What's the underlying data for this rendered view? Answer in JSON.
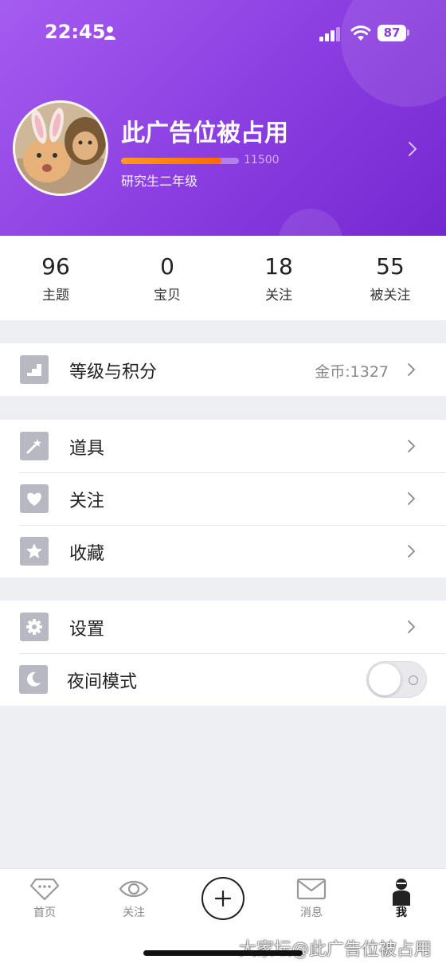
{
  "status_bar": {
    "time": "22:45",
    "battery": "87"
  },
  "profile": {
    "name": "此广告位被占用",
    "progress_value": "11500",
    "progress_fraction": 0.85,
    "level": "研究生二年级"
  },
  "stats": [
    {
      "value": "96",
      "label": "主题"
    },
    {
      "value": "0",
      "label": "宝贝"
    },
    {
      "value": "18",
      "label": "关注"
    },
    {
      "value": "55",
      "label": "被关注"
    }
  ],
  "menu": {
    "level_points": {
      "label": "等级与积分",
      "value": "金币:1327",
      "icon": "stairs-icon"
    },
    "tools": {
      "label": "道具",
      "icon": "magic-wand-icon"
    },
    "follow": {
      "label": "关注",
      "icon": "heart-icon"
    },
    "favorites": {
      "label": "收藏",
      "icon": "star-icon"
    },
    "settings": {
      "label": "设置",
      "icon": "gear-icon"
    },
    "night_mode": {
      "label": "夜间模式",
      "icon": "moon-icon",
      "enabled": false
    }
  },
  "tabbar": {
    "home": "首页",
    "follow": "关注",
    "messages": "消息",
    "me": "我"
  },
  "watermark": "大家坛@此广告位被占用",
  "colors": {
    "header_start": "#a55cf0",
    "header_end": "#7428d0",
    "progress": "#ff7a0f",
    "icon_bg": "#b7b8c2"
  }
}
